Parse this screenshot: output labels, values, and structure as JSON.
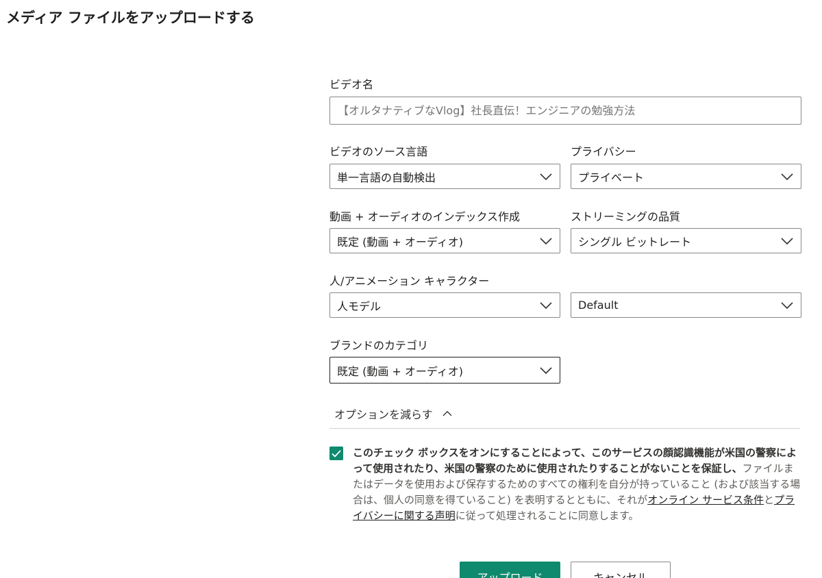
{
  "page": {
    "title": "メディア ファイルをアップロードする"
  },
  "form": {
    "video_name": {
      "label": "ビデオ名",
      "placeholder": "【オルタナティブなVlog】社長直伝！エンジニアの勉強方法"
    },
    "source_language": {
      "label": "ビデオのソース言語",
      "value": "単一言語の自動検出"
    },
    "privacy": {
      "label": "プライバシー",
      "value": "プライベート"
    },
    "indexing": {
      "label": "動画 + オーディオのインデックス作成",
      "value": "既定 (動画 + オーディオ)"
    },
    "streaming_quality": {
      "label": "ストリーミングの品質",
      "value": "シングル ビットレート"
    },
    "people_animation": {
      "label": "人/アニメーション キャラクター",
      "value": "人モデル"
    },
    "people_animation_secondary": {
      "value": "Default"
    },
    "brand_category": {
      "label": "ブランドのカテゴリ",
      "value": "既定 (動画 + オーディオ)"
    },
    "options_toggle": {
      "label": "オプションを減らす"
    }
  },
  "consent": {
    "checked": true,
    "strong_text": "このチェック ボックスをオンにすることによって、このサービスの顔認識機能が米国の警察によって使用されたり、米国の警察のために使用されたりすることがないことを保証し、",
    "text_1": "ファイルまたはデータを使用および保存するためのすべての権利を自分が持っていること (および該当する場合は、個人の同意を得ていること) を表明するとともに、それが",
    "link_1": "オンライン サービス条件",
    "text_2": "と",
    "link_2": "プライバシーに関する声明",
    "text_3": "に従って処理されることに同意します。"
  },
  "buttons": {
    "upload": "アップロード",
    "cancel": "キャンセル"
  },
  "colors": {
    "accent": "#0f8a6e",
    "border": "#8a8886",
    "text": "#201f1e"
  }
}
